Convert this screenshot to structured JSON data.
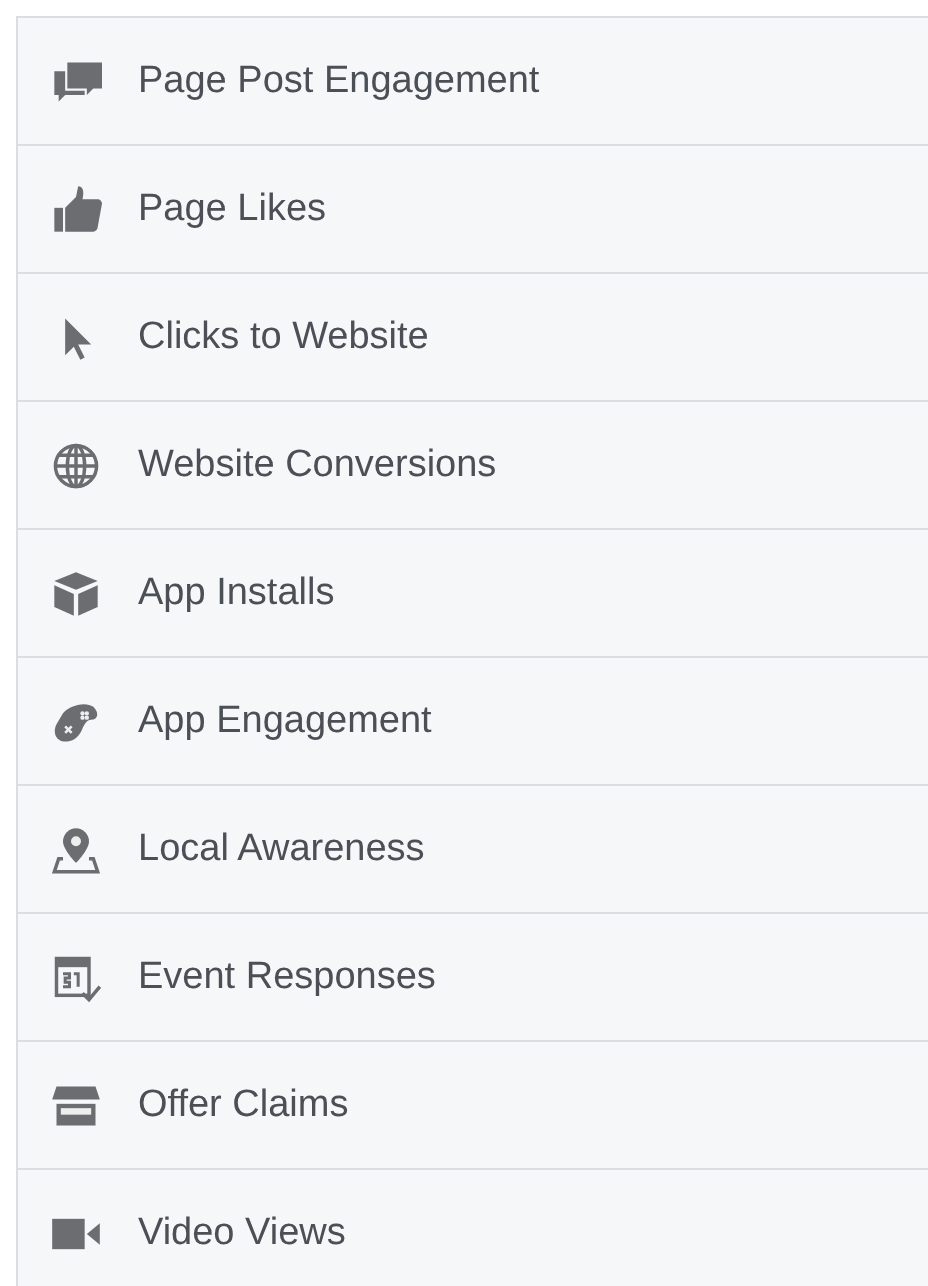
{
  "objectives": [
    {
      "label": "Page Post Engagement"
    },
    {
      "label": "Page Likes"
    },
    {
      "label": "Clicks to Website"
    },
    {
      "label": "Website Conversions"
    },
    {
      "label": "App Installs"
    },
    {
      "label": "App Engagement"
    },
    {
      "label": "Local Awareness"
    },
    {
      "label": "Event Responses"
    },
    {
      "label": "Offer Claims"
    },
    {
      "label": "Video Views"
    }
  ]
}
